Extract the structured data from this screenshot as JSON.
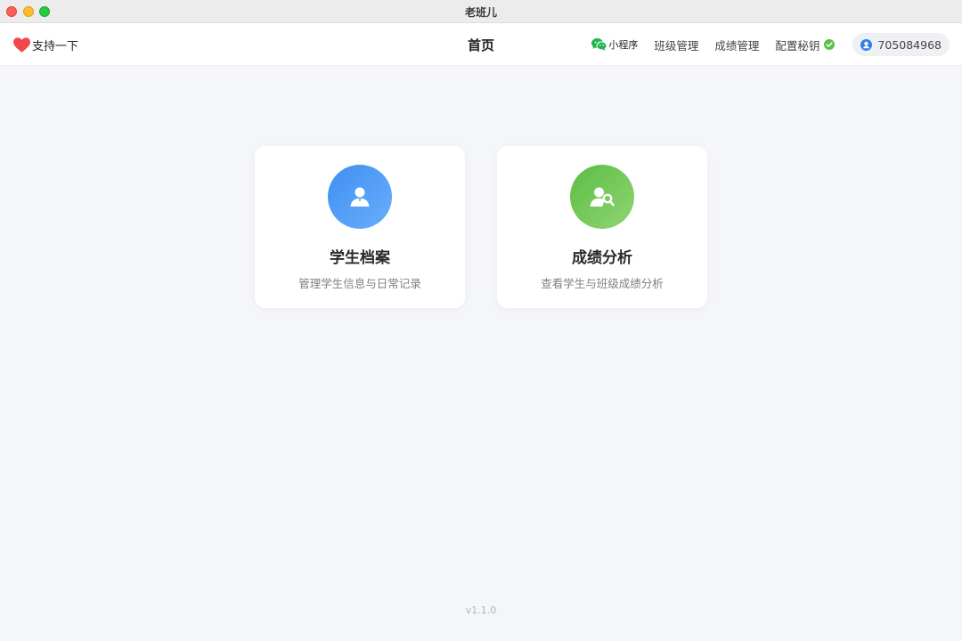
{
  "window": {
    "title": "老班儿"
  },
  "header": {
    "support_label": "支持一下",
    "page_title": "首页",
    "nav": {
      "miniprogram": "小程序",
      "class_manage": "班级管理",
      "score_manage": "成绩管理",
      "config_key": "配置秘钥"
    },
    "user_id": "705084968"
  },
  "cards": [
    {
      "title": "学生档案",
      "desc": "管理学生信息与日常记录",
      "icon": "person-icon"
    },
    {
      "title": "成绩分析",
      "desc": "查看学生与班级成绩分析",
      "icon": "person-search-icon"
    }
  ],
  "footer": {
    "version": "v1.1.0"
  },
  "colors": {
    "accent_blue": "#4a97f5",
    "accent_green": "#6cc553",
    "check_green": "#5bc248",
    "heart_red": "#f2484b",
    "wechat_green": "#22b553"
  }
}
